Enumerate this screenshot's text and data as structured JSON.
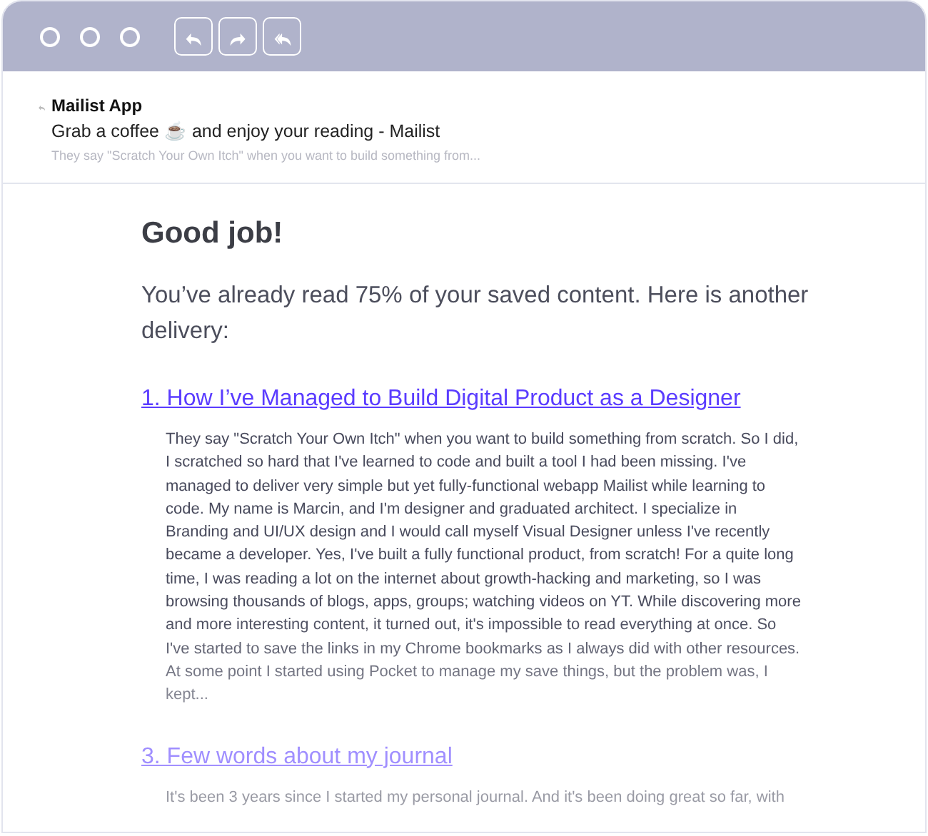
{
  "toolbar": {
    "buttons": [
      {
        "kind": "reply"
      },
      {
        "kind": "forward"
      },
      {
        "kind": "reply_all"
      }
    ]
  },
  "email": {
    "sender": "Mailist App",
    "subject": "Grab a coffee ☕ and enjoy your reading - Mailist",
    "preview": "They say \"Scratch Your Own Itch\" when you want to build something from..."
  },
  "message": {
    "heading": "Good job!",
    "intro": "You’ve already read 75% of your saved content. Here is another delivery:",
    "articles": [
      {
        "title": "1. How I’ve Managed to Build Digital Product as a Designer",
        "excerpt": "They say \"Scratch Your Own Itch\" when you want to build something from scratch. So I did, I scratched so hard that I've learned to code and built a tool I had been missing. I've managed to deliver very simple but yet fully-functional webapp Mailist while learning to code. My name is Marcin, and I'm designer and graduated architect. I specialize in Branding and UI/UX design and I would call myself Visual Designer unless I've recently became a developer. Yes, I've built a fully functional product, from scratch! For a quite long time, I was reading a lot on the internet about growth-hacking and marketing, so I was browsing thousands of blogs, apps, groups; watching videos on YT. While discovering more and more interesting content, it turned out, it's impossible to read everything at once. So I've started to save the links in my Chrome bookmarks as I always did with other resources. At some point I started using Pocket to manage my save things, but the problem was, I kept..."
      },
      {
        "title": "3. Few words about my journal",
        "excerpt": "It's been 3 years since I started my personal journal. And it's been doing great so far, with"
      }
    ]
  }
}
